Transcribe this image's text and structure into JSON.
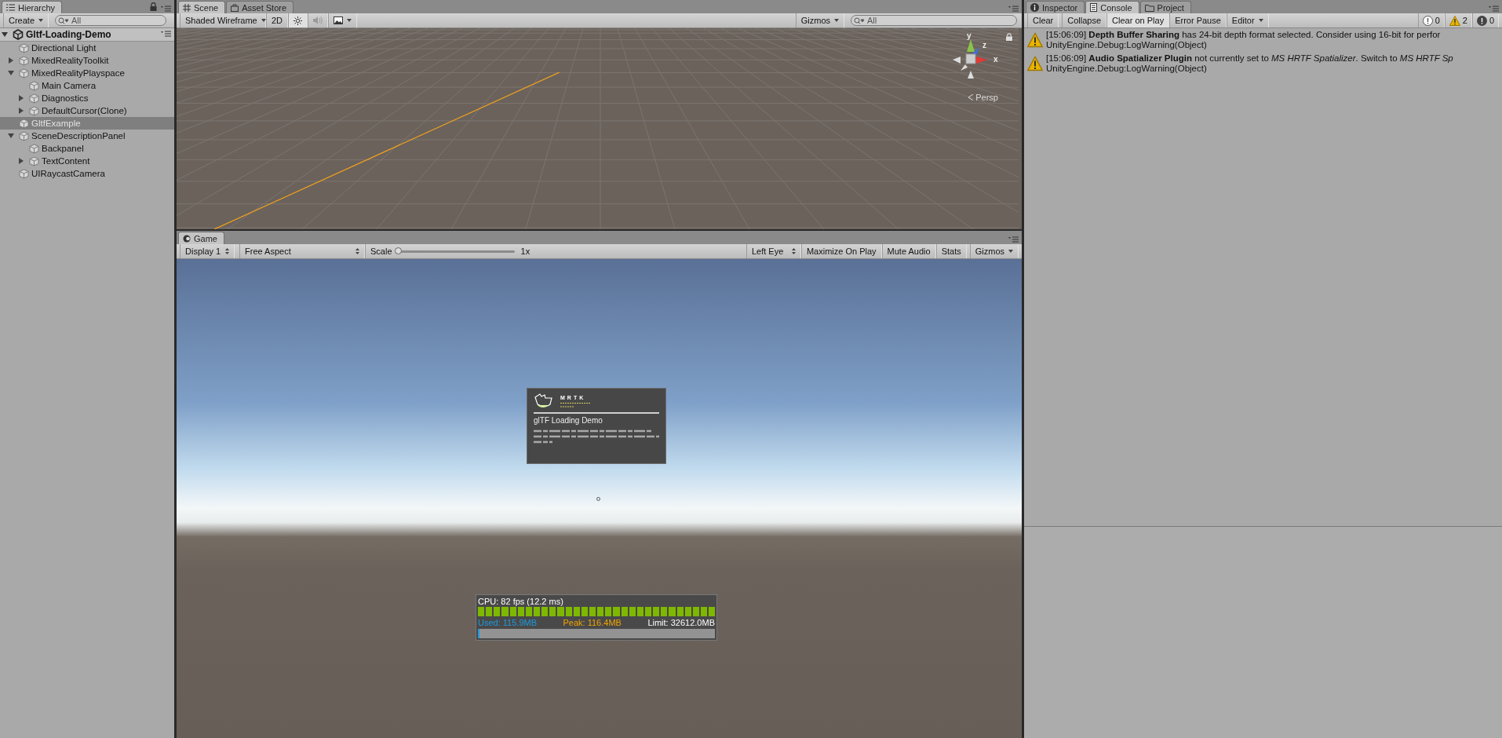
{
  "hierarchy": {
    "title": "Hierarchy",
    "create_label": "Create",
    "search_placeholder": "All",
    "scene_name": "Gltf-Loading-Demo",
    "items": [
      {
        "label": "Directional Light",
        "kind": "leaf",
        "selected": false
      },
      {
        "label": "MixedRealityToolkit",
        "kind": "collapsed",
        "selected": false
      },
      {
        "label": "MixedRealityPlayspace",
        "kind": "expanded",
        "selected": false,
        "children": [
          {
            "label": "Main Camera",
            "kind": "leaf",
            "selected": false
          },
          {
            "label": "Diagnostics",
            "kind": "collapsed",
            "selected": false
          },
          {
            "label": "DefaultCursor(Clone)",
            "kind": "collapsed",
            "selected": false
          }
        ]
      },
      {
        "label": "GltfExample",
        "kind": "leaf",
        "selected": true
      },
      {
        "label": "SceneDescriptionPanel",
        "kind": "expanded",
        "selected": false,
        "children": [
          {
            "label": "Backpanel",
            "kind": "leaf",
            "selected": false
          },
          {
            "label": "TextContent",
            "kind": "collapsed",
            "selected": false
          }
        ]
      },
      {
        "label": "UIRaycastCamera",
        "kind": "leaf",
        "selected": false
      }
    ]
  },
  "scene": {
    "tabs": [
      {
        "label": "Scene",
        "selected": true
      },
      {
        "label": "Asset Store",
        "selected": false
      }
    ],
    "draw_mode": "Shaded Wireframe",
    "mode_2d": "2D",
    "gizmos": "Gizmos",
    "search_placeholder": "All",
    "axes": {
      "y": "y",
      "z": "z",
      "x": "x"
    },
    "projection": "Persp"
  },
  "game": {
    "tab": "Game",
    "display": "Display 1",
    "aspect": "Free Aspect",
    "scale_label": "Scale",
    "scale": {
      "level": 0
    },
    "scale_value": "1x",
    "eye": "Left Eye",
    "buttons": [
      "Maximize On Play",
      "Mute Audio",
      "Stats",
      "Gizmos"
    ],
    "card": {
      "logo": "MRTK",
      "title": "glTF Loading Demo"
    },
    "stats": {
      "cpu": "CPU: 82 fps (12.2 ms)",
      "cpu_meter": {
        "level": 1
      },
      "used": "Used: 115.9MB",
      "peak": "Peak: 116.4MB",
      "limit": "Limit: 32612.0MB",
      "memory_meter": {
        "level": 0.004
      }
    }
  },
  "console": {
    "tabs": [
      {
        "label": "Inspector",
        "selected": false
      },
      {
        "label": "Console",
        "selected": true
      },
      {
        "label": "Project",
        "selected": false
      }
    ],
    "buttons": [
      {
        "label": "Clear",
        "pressed": false
      },
      {
        "label": "Collapse",
        "pressed": false
      },
      {
        "label": "Clear on Play",
        "pressed": true
      },
      {
        "label": "Error Pause",
        "pressed": false
      }
    ],
    "editor": "Editor",
    "counts": [
      {
        "kind": "info",
        "count": "0"
      },
      {
        "kind": "warning",
        "count": "2"
      },
      {
        "kind": "error",
        "count": "0"
      }
    ],
    "messages": [
      {
        "kind": "warning",
        "text": "[15:06:09] **Depth Buffer Sharing** has 24-bit depth format selected. Consider using 16-bit for perfor",
        "source": "UnityEngine.Debug:LogWarning(Object)"
      },
      {
        "kind": "warning",
        "text": "[15:06:09] **Audio Spatializer Plugin** not currently set to *MS HRTF Spatializer*. Switch to *MS HRTF Sp*",
        "source": "UnityEngine.Debug:LogWarning(Object)"
      }
    ]
  }
}
